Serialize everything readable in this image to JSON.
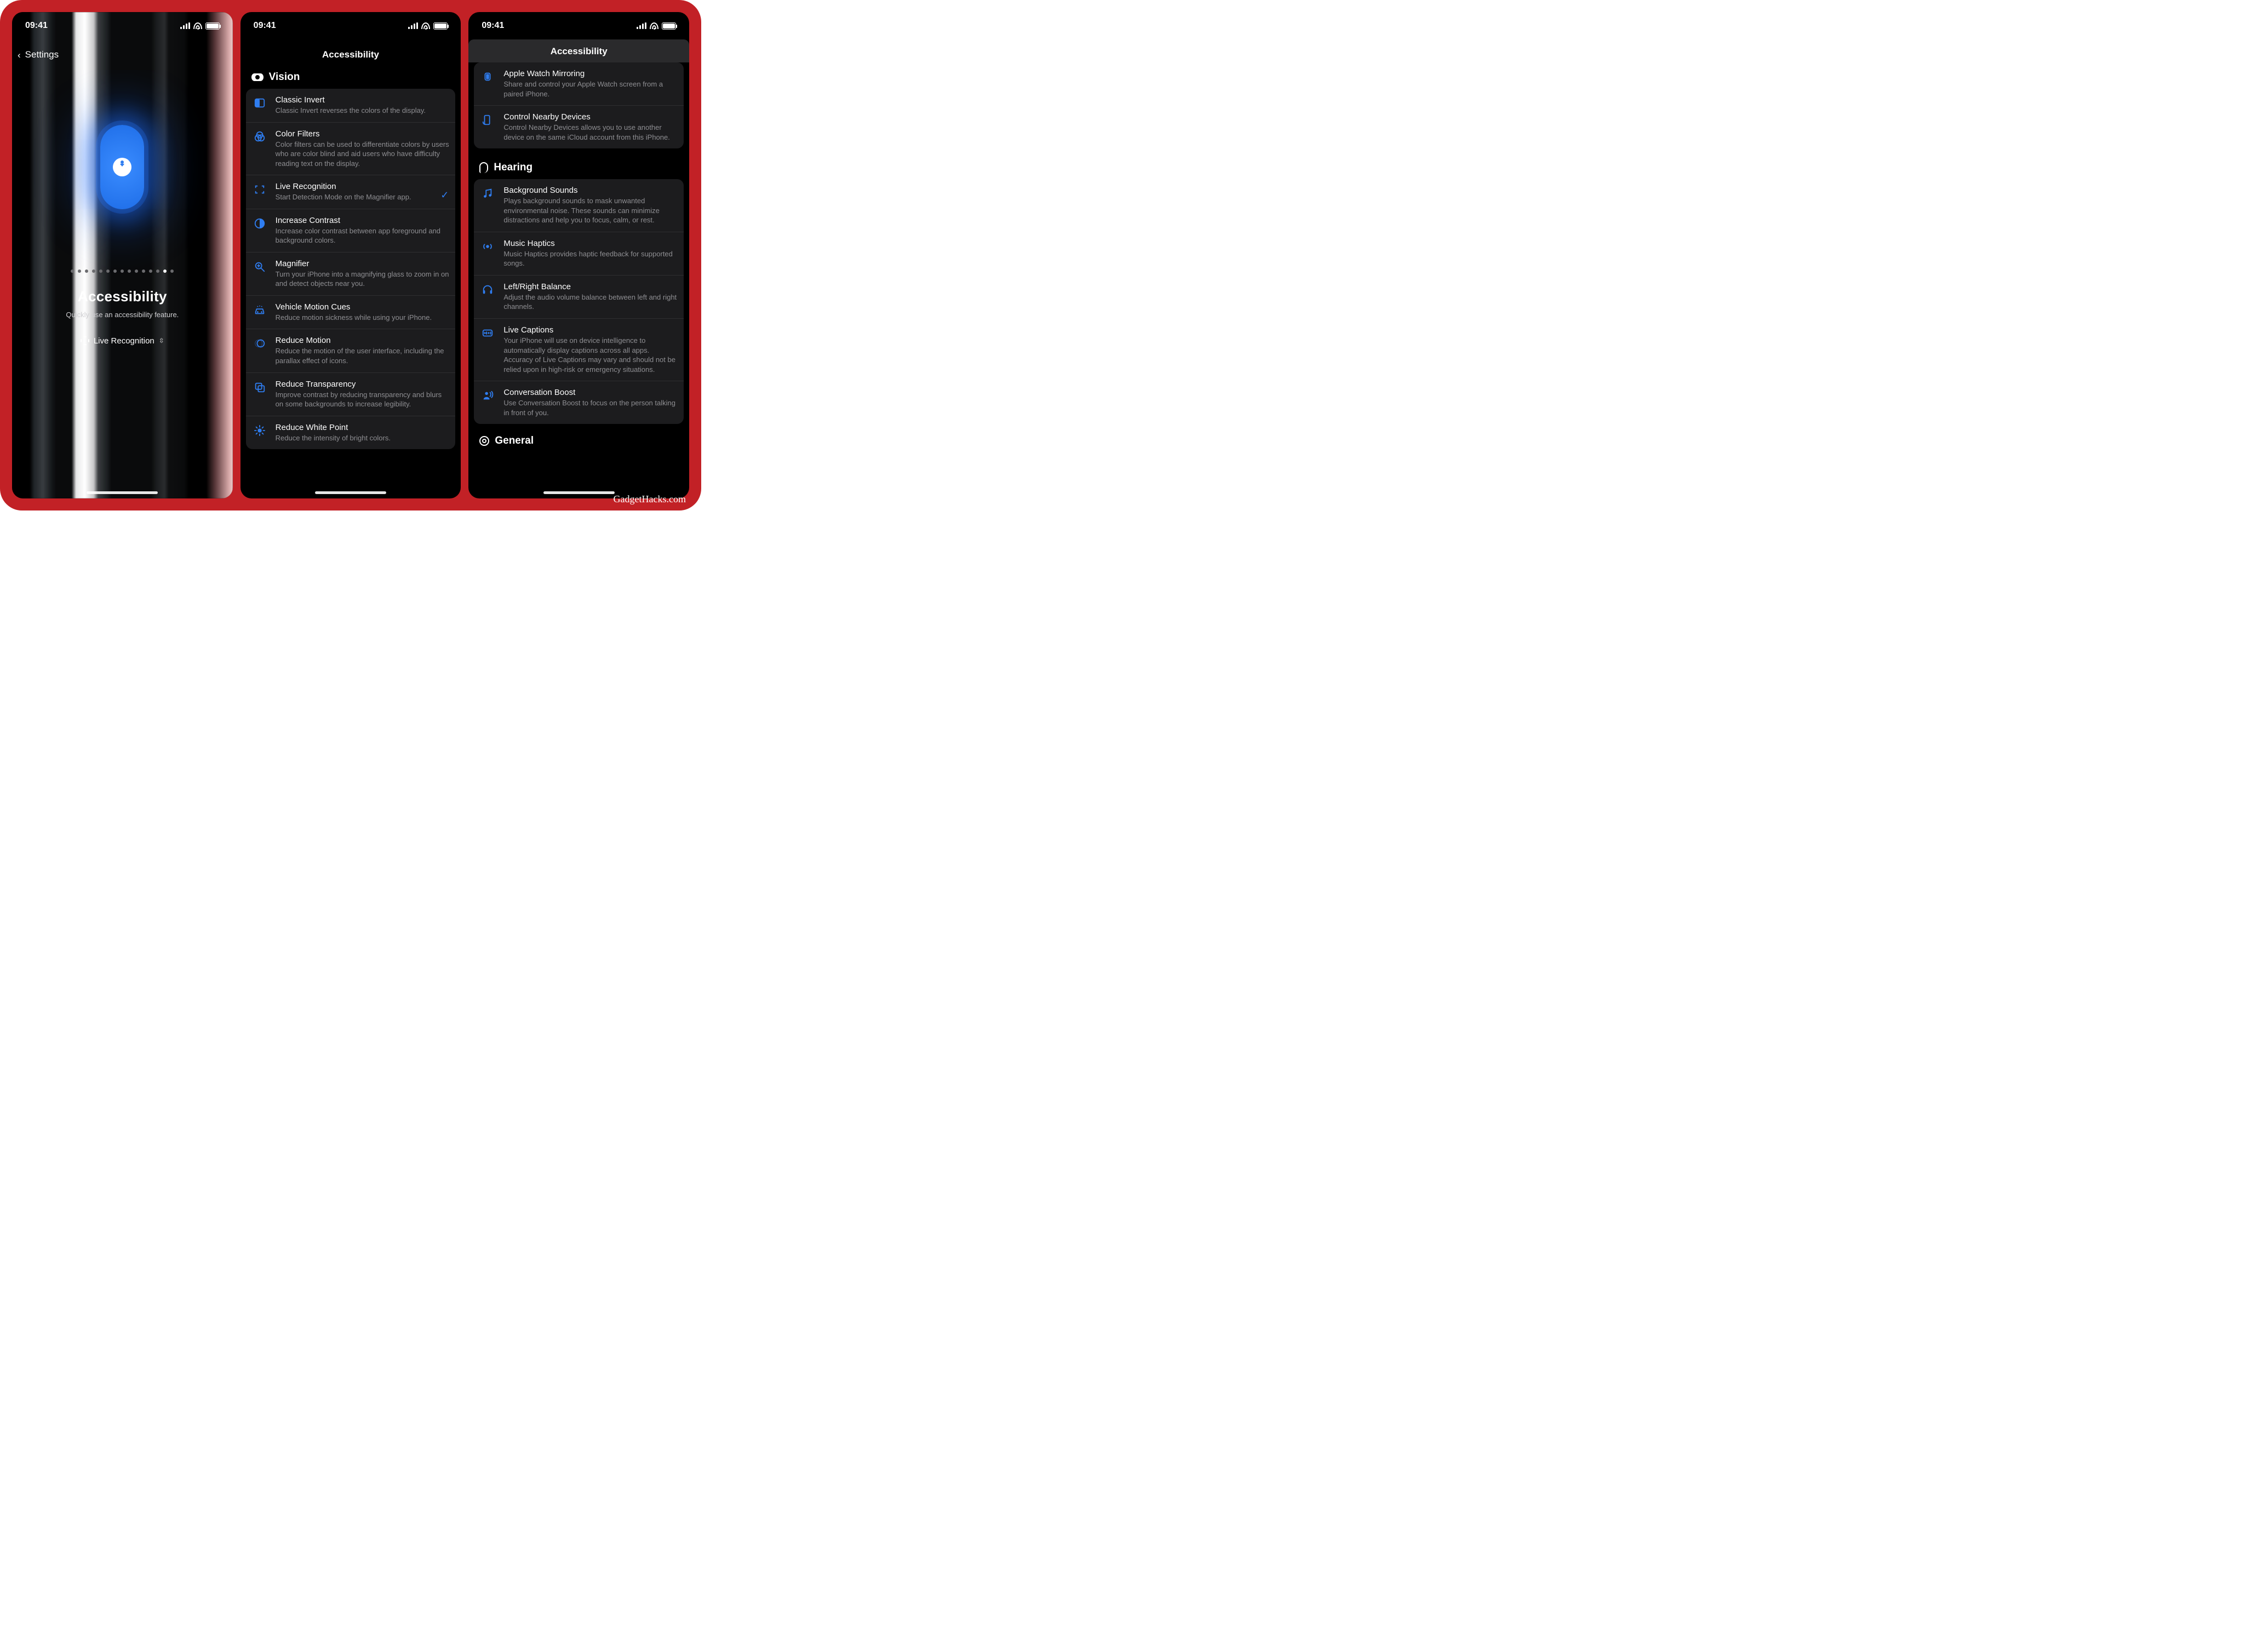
{
  "watermark": "GadgetHacks.com",
  "status": {
    "time": "09:41"
  },
  "screen1": {
    "back": "Settings",
    "title": "Accessibility",
    "subtitle": "Quickly use an accessibility feature.",
    "chooser": "Live Recognition",
    "dot_count": 15,
    "active_dot": 13
  },
  "screen2": {
    "title": "Accessibility",
    "section": "Vision",
    "rows": [
      {
        "icon": "half-circle",
        "t": "Classic Invert",
        "s": "Classic Invert reverses the colors of the display."
      },
      {
        "icon": "venn",
        "t": "Color Filters",
        "s": "Color filters can be used to differentiate colors by users who are color blind and aid users who have difficulty reading text on the display."
      },
      {
        "icon": "brackets",
        "t": "Live Recognition",
        "s": "Start Detection Mode on the Magnifier app.",
        "checked": true
      },
      {
        "icon": "contrast",
        "t": "Increase Contrast",
        "s": "Increase color contrast between app foreground and background colors."
      },
      {
        "icon": "magnifier",
        "t": "Magnifier",
        "s": "Turn your iPhone into a magnifying glass to zoom in on and detect objects near you."
      },
      {
        "icon": "car",
        "t": "Vehicle Motion Cues",
        "s": "Reduce motion sickness while using your iPhone."
      },
      {
        "icon": "motion",
        "t": "Reduce Motion",
        "s": "Reduce the motion of the user interface, including the parallax effect of icons."
      },
      {
        "icon": "transparency",
        "t": "Reduce Transparency",
        "s": "Improve contrast by reducing transparency and blurs on some backgrounds to increase legibility."
      },
      {
        "icon": "sun",
        "t": "Reduce White Point",
        "s": "Reduce the intensity of bright colors."
      }
    ]
  },
  "screen3": {
    "title": "Accessibility",
    "top_rows": [
      {
        "icon": "watch",
        "t": "Apple Watch Mirroring",
        "s": "Share and control your Apple Watch screen from a paired iPhone."
      },
      {
        "icon": "nearby",
        "t": "Control Nearby Devices",
        "s": "Control Nearby Devices allows you to use another device on the same iCloud account from this iPhone."
      }
    ],
    "section": "Hearing",
    "rows": [
      {
        "icon": "music",
        "t": "Background Sounds",
        "s": "Plays background sounds to mask unwanted environmental noise. These sounds can minimize distractions and help you to focus, calm, or rest."
      },
      {
        "icon": "haptics",
        "t": "Music Haptics",
        "s": "Music Haptics provides haptic feedback for supported songs."
      },
      {
        "icon": "headphones",
        "t": "Left/Right Balance",
        "s": "Adjust the audio volume balance between left and right channels."
      },
      {
        "icon": "captions",
        "t": "Live Captions",
        "s": "Your iPhone will use on device intelligence to automatically display captions across all apps. Accuracy of Live Captions may vary and should not be relied upon in high-risk or emergency situations."
      },
      {
        "icon": "person-wave",
        "t": "Conversation Boost",
        "s": "Use Conversation Boost to focus on the person talking in front of you."
      }
    ],
    "section2": "General"
  }
}
